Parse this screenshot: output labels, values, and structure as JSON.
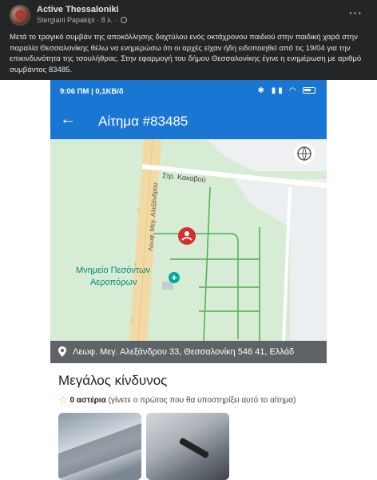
{
  "post": {
    "page_name": "Active Thessaloniki",
    "author": "Stergiani Papakipi",
    "time": "8 λ.",
    "body": "Μετά το τραγικό συμβάν της αποκόλλησης δαχτύλου ενός οκτάχρονου παιδιού στην παιδική χαρά στην παραλία Θεσσαλονίκης θέλω να ενημερώσω ότι οι αρχές είχαν ήδη ειδοποιηθεί από τις 19/04 για την επικινδυνότητα της τσουλήθρας. Στην εφαρμογή του δήμου Θεσσαλονίκης έγινε η ενημέρωση με αριθμό συμβάντος 83485.",
    "more_icon": "more-options-icon"
  },
  "screenshot": {
    "status": {
      "time": "9:06 ΠΜ | 0,1KB/δ",
      "accent": "#1976d2"
    },
    "appbar": {
      "title": "Αίτημα #83485"
    },
    "map": {
      "street_label": "Στρ. Κακαβού",
      "avenue_label": "Λεωφ. Μεγ. Αλεξάνδρου",
      "poi_label_1": "Μνημείο Πεσόντων",
      "poi_label_2": "Αεροπόρων",
      "pin_color": "#d32f2f"
    },
    "address": "Λεωφ. Μεγ. Αλεξάνδρου 33, Θεσσαλονίκη 546 41, Ελλάδ",
    "severity": "Μεγάλος κίνδυνος",
    "stars_count": "0 αστέρια",
    "stars_hint": "(γίνετε ο πρώτος που θα υποστηρίξει αυτό το αίτημα)"
  }
}
